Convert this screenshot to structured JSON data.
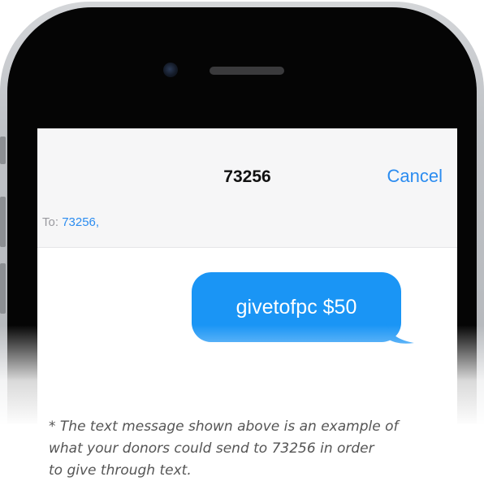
{
  "phone": {
    "frame_color": "#c3c6ca",
    "screen_color": "#ffffff"
  },
  "header": {
    "title": "73256",
    "cancel_label": "Cancel",
    "to_label": "To:",
    "recipient": "73256,"
  },
  "message": {
    "text": "givetofpc $50",
    "bubble_color": "#1a95f5"
  },
  "caption": {
    "lines": [
      "* The text message shown above is an example of",
      "what your donors could send to 73256 in order",
      "to give through text."
    ]
  },
  "colors": {
    "accent": "#2b8cf0",
    "caption_text": "#555555"
  }
}
